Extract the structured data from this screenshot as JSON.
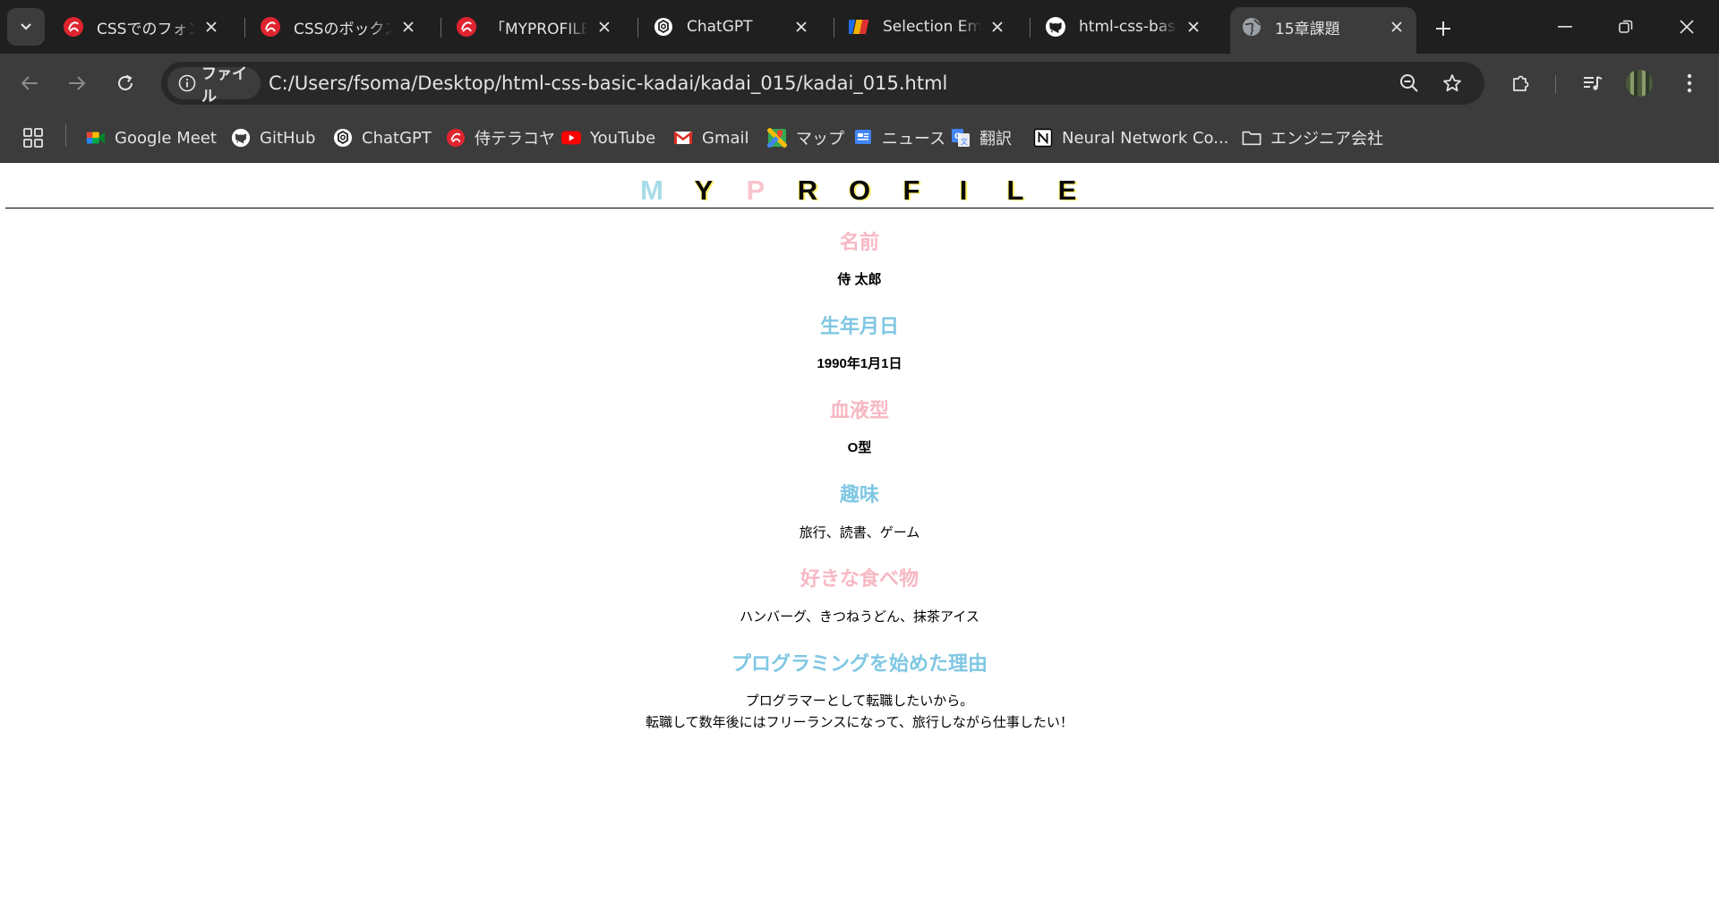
{
  "browser": {
    "tabs": [
      {
        "title": "CSSでのフォント",
        "favicon": "samurai-icon",
        "active": false
      },
      {
        "title": "CSSのボックスモ",
        "favicon": "samurai-icon",
        "active": false
      },
      {
        "title": "「MYPROFILE」",
        "favicon": "samurai-icon",
        "active": false
      },
      {
        "title": "ChatGPT",
        "favicon": "chatgpt-icon",
        "active": false
      },
      {
        "title": "Selection Emb",
        "favicon": "colorful-logo-icon",
        "active": false
      },
      {
        "title": "html-css-basic",
        "favicon": "github-icon",
        "active": false
      },
      {
        "title": "15章課題",
        "favicon": "globe-icon",
        "active": true
      }
    ],
    "address_bar": {
      "chip_label": "ファイル",
      "url": "C:/Users/fsoma/Desktop/html-css-basic-kadai/kadai_015/kadai_015.html"
    },
    "bookmarks": [
      {
        "label": "Google Meet",
        "icon": "google-meet-icon"
      },
      {
        "label": "GitHub",
        "icon": "github-icon"
      },
      {
        "label": "ChatGPT",
        "icon": "chatgpt-icon"
      },
      {
        "label": "侍テラコヤ",
        "icon": "samurai-icon"
      },
      {
        "label": "YouTube",
        "icon": "youtube-icon"
      },
      {
        "label": "Gmail",
        "icon": "gmail-icon"
      },
      {
        "label": "マップ",
        "icon": "maps-icon"
      },
      {
        "label": "ニュース",
        "icon": "news-icon"
      },
      {
        "label": "翻訳",
        "icon": "translate-icon"
      },
      {
        "label": "Neural Network Co...",
        "icon": "notion-icon"
      },
      {
        "label": "エンジニア会社",
        "icon": "folder-icon"
      }
    ],
    "colors": {
      "tabstrip_bg": "#1f1f1f",
      "toolbar_bg": "#3c3c3c",
      "omnibox_bg": "#282828",
      "samurai_red": "#e0242f"
    }
  },
  "page": {
    "logo_letters": [
      "M",
      "Y",
      "P",
      "R",
      "O",
      "F",
      "I",
      "L",
      "E"
    ],
    "sections": [
      {
        "heading": "名前",
        "value": "侍 太郎"
      },
      {
        "heading": "生年月日",
        "value": "1990年1月1日"
      },
      {
        "heading": "血液型",
        "value": "O型"
      },
      {
        "heading": "趣味",
        "value": "旅行、読書、ゲーム"
      },
      {
        "heading": "好きな食べ物",
        "value": "ハンバーグ、きつねうどん、抹茶アイス"
      },
      {
        "heading": "プログラミングを始めた理由",
        "value_lines": [
          "プログラマーとして転職したいから。",
          "転職して数年後にはフリーランスになって、旅行しながら仕事したい！"
        ]
      }
    ],
    "colors": {
      "heading_pink": "#f7b8c3",
      "heading_blue": "#7fc7e3",
      "logo_yellow": "#fff266"
    }
  }
}
